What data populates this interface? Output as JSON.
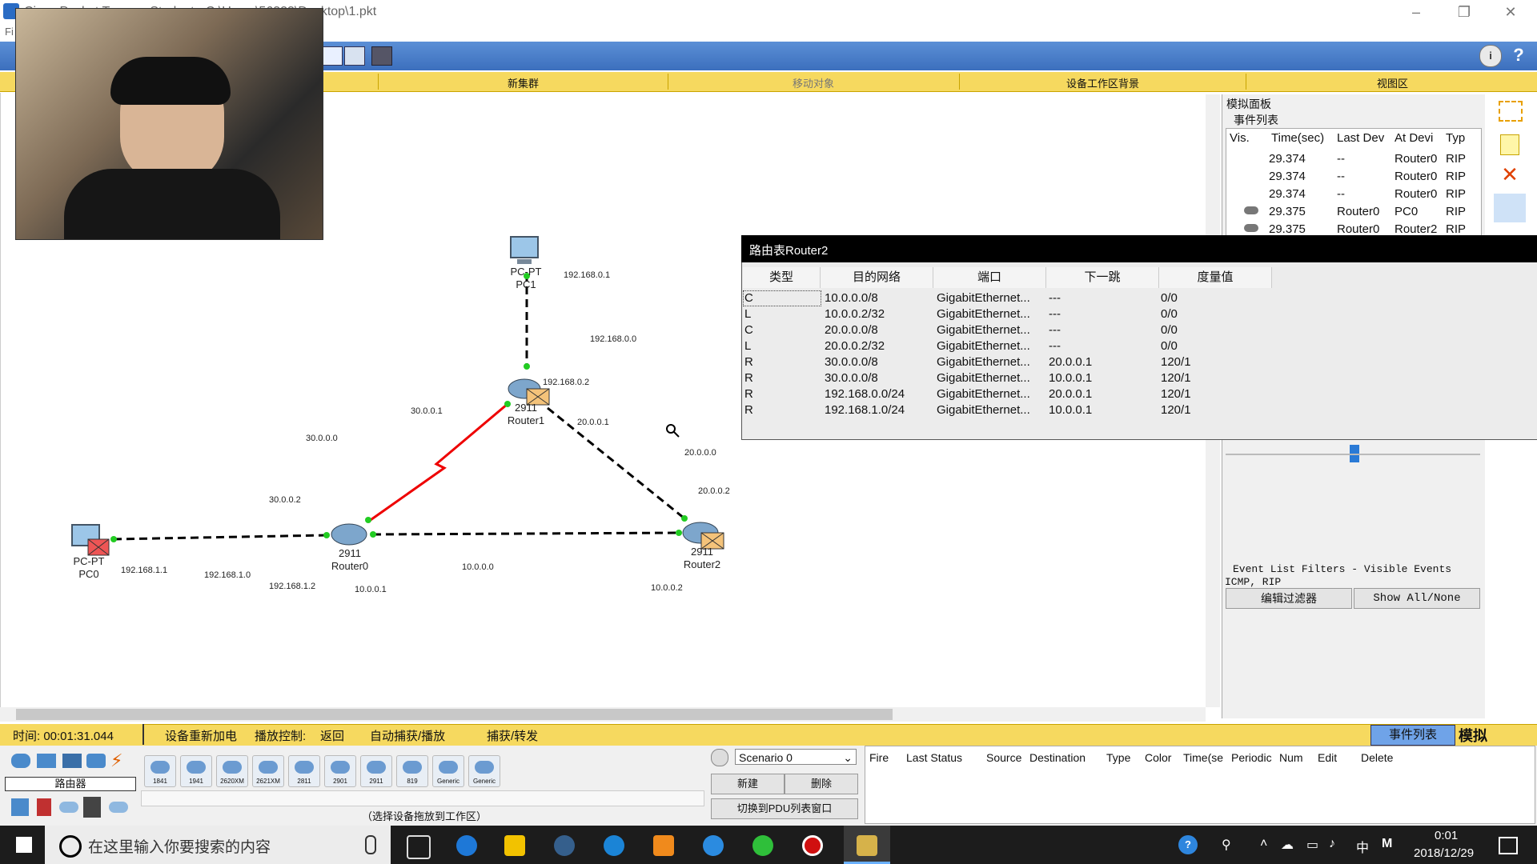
{
  "window": {
    "title": "Cisco Packet Tracer - Student - C:\\Users\\56323\\Desktop\\1.pkt",
    "menu_first": "Fi",
    "controls": {
      "minimize": "–",
      "maximize": "❐",
      "close": "✕"
    }
  },
  "logical_bar": {
    "new_cluster": "新集群",
    "move_object": "移动对象",
    "set_background": "设备工作区背景",
    "viewport": "视图区"
  },
  "topology": {
    "devices": {
      "pc1": {
        "type": "PC-PT",
        "name": "PC1"
      },
      "pc0": {
        "type": "PC-PT",
        "name": "PC0"
      },
      "router1": {
        "model": "2911",
        "name": "Router1"
      },
      "router0": {
        "model": "2911",
        "name": "Router0"
      },
      "router2": {
        "model": "2911",
        "name": "Router2"
      }
    },
    "labels": {
      "pc1_ip": "192.168.0.1",
      "net_192_168_0": "192.168.0.0",
      "r1_g": "192.168.0.2",
      "r1_30": "30.0.0.1",
      "net_30": "30.0.0.0",
      "r0_30": "30.0.0.2",
      "r1_20": "20.0.0.1",
      "net_20": "20.0.0.0",
      "r2_20": "20.0.0.2",
      "pc0_ip": "192.168.1.1",
      "net_192_168_1": "192.168.1.0",
      "r0_g": "192.168.1.2",
      "r0_10": "10.0.0.1",
      "net_10": "10.0.0.0",
      "r2_10": "10.0.0.2"
    }
  },
  "sim_panel": {
    "title": "模拟面板",
    "event_list_title": "事件列表",
    "columns": [
      "Vis.",
      "Time(sec)",
      "Last Dev",
      "At Devi",
      "Typ"
    ],
    "events": [
      {
        "vis": "",
        "time": "29.374",
        "last": "--",
        "at": "Router0",
        "type": "RIP"
      },
      {
        "vis": "",
        "time": "29.374",
        "last": "--",
        "at": "Router0",
        "type": "RIP"
      },
      {
        "vis": "",
        "time": "29.374",
        "last": "--",
        "at": "Router0",
        "type": "RIP"
      },
      {
        "vis": "eye",
        "time": "29.375",
        "last": "Router0",
        "at": "PC0",
        "type": "RIP"
      },
      {
        "vis": "eye",
        "time": "29.375",
        "last": "Router0",
        "at": "Router2",
        "type": "RIP"
      }
    ],
    "filters_line1": "Event List Filters - Visible Events",
    "filters_line2": "ICMP, RIP",
    "edit_filters": "编辑过滤器",
    "show_all": "Show All/None"
  },
  "routing_table": {
    "title": "路由表Router2",
    "headers": [
      "类型",
      "目的网络",
      "端口",
      "下一跳",
      "度量值"
    ],
    "rows": [
      [
        "C",
        "10.0.0.0/8",
        "GigabitEthernet...",
        "---",
        "0/0"
      ],
      [
        "L",
        "10.0.0.2/32",
        "GigabitEthernet...",
        "---",
        "0/0"
      ],
      [
        "C",
        "20.0.0.0/8",
        "GigabitEthernet...",
        "---",
        "0/0"
      ],
      [
        "L",
        "20.0.0.2/32",
        "GigabitEthernet...",
        "---",
        "0/0"
      ],
      [
        "R",
        "30.0.0.0/8",
        "GigabitEthernet...",
        "20.0.0.1",
        "120/1"
      ],
      [
        "R",
        "30.0.0.0/8",
        "GigabitEthernet...",
        "10.0.0.1",
        "120/1"
      ],
      [
        "R",
        "192.168.0.0/24",
        "GigabitEthernet...",
        "20.0.0.1",
        "120/1"
      ],
      [
        "R",
        "192.168.1.0/24",
        "GigabitEthernet...",
        "10.0.0.1",
        "120/1"
      ]
    ]
  },
  "status_bar": {
    "time": "时间: 00:01:31.044",
    "power_cycle": "设备重新加电",
    "playback": "播放控制:",
    "back": "返回",
    "auto_capture": "自动捕获/播放",
    "capture_forward": "捕获/转发",
    "event_list_btn": "事件列表",
    "mode": "模拟"
  },
  "palette": {
    "category": "路由器",
    "devices": [
      "1841",
      "1941",
      "2620XM",
      "2621XM",
      "2811",
      "2901",
      "2911",
      "819",
      "Generic",
      "Generic"
    ],
    "hint": "（选择设备拖放到工作区）"
  },
  "scenario": {
    "selected": "Scenario 0",
    "new": "新建",
    "delete": "删除",
    "toggle_pdu": "切换到PDU列表窗口",
    "pdu_columns": [
      "Fire",
      "Last Status",
      "Source",
      "Destination",
      "Type",
      "Color",
      "Time(se",
      "Periodic",
      "Num",
      "Edit",
      "Delete"
    ]
  },
  "taskbar": {
    "search_placeholder": "在这里输入你要搜索的内容",
    "time": "0:01",
    "date": "2018/12/29",
    "ime": "中",
    "ime2": "M"
  }
}
